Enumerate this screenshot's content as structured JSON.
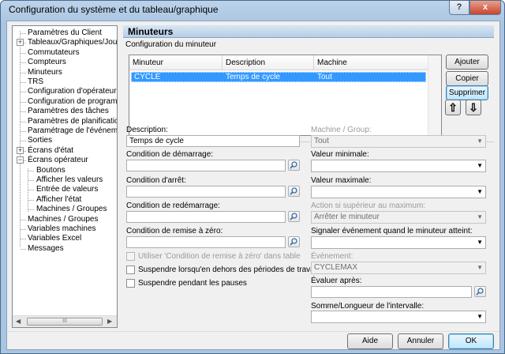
{
  "window": {
    "title": "Configuration du système et du tableau/graphique",
    "help_glyph": "?",
    "close_glyph": "x"
  },
  "tree": {
    "items": [
      {
        "label": "Paramètres du Client"
      },
      {
        "label": "Tableaux/Graphiques/Journaux",
        "expander": "+"
      },
      {
        "label": "Commutateurs"
      },
      {
        "label": "Compteurs"
      },
      {
        "label": "Minuteurs"
      },
      {
        "label": "TRS"
      },
      {
        "label": "Configuration d'opérateur"
      },
      {
        "label": "Configuration de programme"
      },
      {
        "label": "Paramètres des tâches"
      },
      {
        "label": "Paramètres de planification"
      },
      {
        "label": "Paramétrage de l'événement"
      },
      {
        "label": "Sorties"
      },
      {
        "label": "Écrans d'état",
        "expander": "+"
      },
      {
        "label": "Écrans opérateur",
        "expander": "−"
      },
      {
        "label": "Boutons"
      },
      {
        "label": "Afficher les valeurs"
      },
      {
        "label": "Entrée de valeurs"
      },
      {
        "label": "Afficher l'état"
      },
      {
        "label": "Machines / Groupes"
      },
      {
        "label": "Machines / Groupes"
      },
      {
        "label": "Variables machines"
      },
      {
        "label": "Variables Excel"
      },
      {
        "label": "Messages"
      }
    ],
    "scroll_left": "◀",
    "scroll_right": "▶",
    "scroll_grip": "III"
  },
  "panel": {
    "title": "Minuteurs",
    "section_label": "Configuration du minuteur",
    "grid": {
      "columns": [
        "Minuteur",
        "Description",
        "Machine"
      ],
      "rows": [
        {
          "minuteur": "CYCLE",
          "description": "Temps de cycle",
          "machine": "Tout"
        }
      ]
    },
    "buttons": {
      "add": "Ajouter",
      "copy": "Copier",
      "delete": "Supprimer",
      "up_glyph": "⇧",
      "down_glyph": "⇩"
    },
    "left": {
      "description_label": "Description:",
      "description_value": "Temps de cycle",
      "start_label": "Condition de démarrage:",
      "start_value": "",
      "stop_label": "Condition d'arrêt:",
      "stop_value": "",
      "restart_label": "Condition de redémarrage:",
      "restart_value": "",
      "reset_label": "Condition de remise à zéro:",
      "reset_value": "",
      "chk_use_reset": "Utiliser 'Condition de remise à zéro' dans tableaux/graphiques",
      "chk_suspend_outside": "Suspendre lorsqu'en dehors des périodes de travail",
      "chk_suspend_breaks": "Suspendre pendant les pauses"
    },
    "right": {
      "machine_label": "Machine / Group:",
      "machine_value": "Tout",
      "min_label": "Valeur minimale:",
      "min_value": "",
      "max_label": "Valeur maximale:",
      "max_value": "",
      "action_label": "Action si supérieur au maximum:",
      "action_value": "Arrêter le minuteur",
      "signal_label": "Signaler événement quand le minuteur atteint:",
      "signal_value": "",
      "event_label": "Événement:",
      "event_value": "CYCLEMAX",
      "evaluate_label": "Évaluer après:",
      "evaluate_value": "",
      "sum_label": "Somme/Longueur de l'intervalle:",
      "sum_value": ""
    }
  },
  "footer": {
    "help": "Aide",
    "cancel": "Annuler",
    "ok": "OK"
  }
}
